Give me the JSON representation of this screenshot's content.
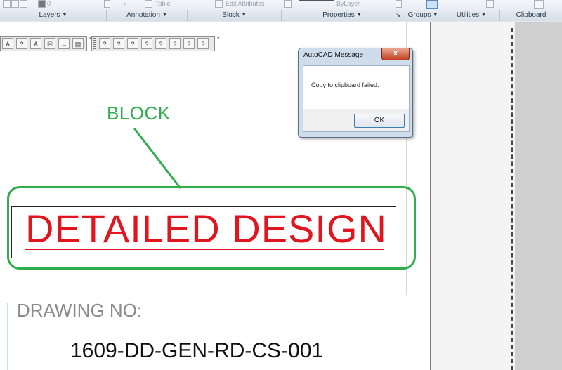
{
  "ribbon": {
    "top_items": {
      "layer_value": "0",
      "table": "Table",
      "edit_attributes": "Edit Attributes",
      "bylayer": "ByLayer"
    },
    "panels": [
      {
        "label": "Layers"
      },
      {
        "label": "Annotation"
      },
      {
        "label": "Block"
      },
      {
        "label": "Properties"
      },
      {
        "label": "Groups"
      },
      {
        "label": "Utilities"
      },
      {
        "label": "Clipboard"
      }
    ]
  },
  "toolbars": {
    "left": [
      "A",
      "?",
      "A",
      "☒",
      "→",
      "▤"
    ],
    "right": [
      "?",
      "?",
      "?",
      "?",
      "?",
      "?",
      "?",
      "?"
    ]
  },
  "dialog": {
    "title": "AutoCAD Message",
    "message": "Copy to clipboard failed.",
    "ok_label": "OK",
    "close_glyph": "x"
  },
  "drawing": {
    "block_label": "BLOCK",
    "design_text": "DETAILED DESIGN",
    "drawing_no_label": "DRAWING NO:",
    "drawing_no_value": "1609-DD-GEN-RD-CS-001"
  },
  "colors": {
    "block_green": "#2fae4d",
    "design_red": "#e0151d",
    "label_gray": "#8a8a8a"
  }
}
